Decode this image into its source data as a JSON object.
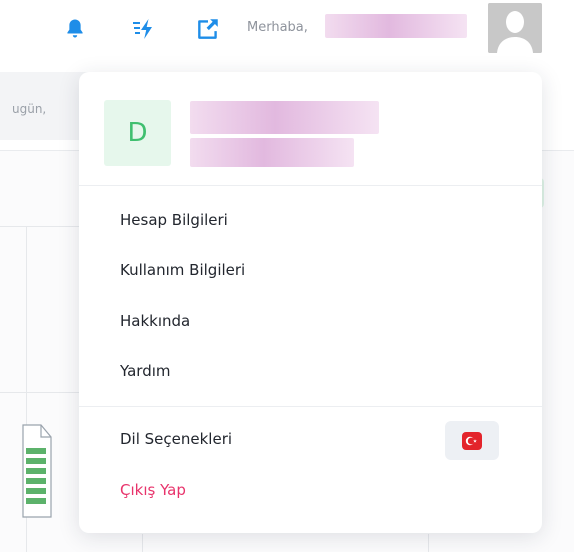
{
  "topbar": {
    "greeting": "Merhaba,",
    "icons": {
      "notifications": "bell-icon",
      "quick_actions": "bolt-icon",
      "share": "share-icon",
      "profile": "user-avatar"
    },
    "accent_color": "#1e8de8"
  },
  "background": {
    "date_fragment": "ugün, "
  },
  "dropdown": {
    "user_initial": "D",
    "menu": {
      "account_info": "Hesap Bilgileri",
      "usage_info": "Kullanım Bilgileri",
      "about": "Hakkında",
      "help": "Yardım"
    },
    "language_options": "Dil Seçenekleri",
    "language_flag": "turkey-flag-icon",
    "logout": "Çıkış Yap",
    "colors": {
      "initial_green": "#3fbf6f",
      "logout_red": "#e8336b"
    }
  }
}
